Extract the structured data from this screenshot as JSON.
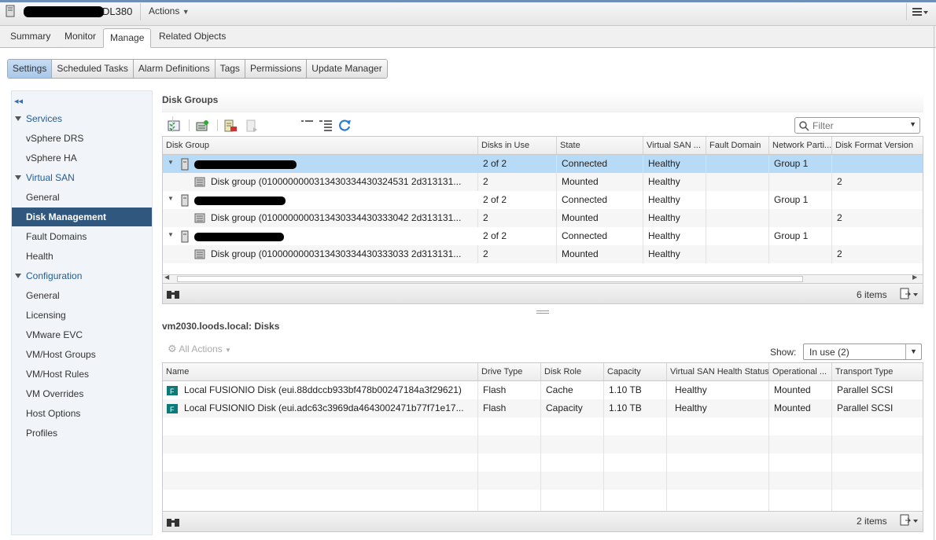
{
  "window": {
    "title": "DL380",
    "actions_label": "Actions"
  },
  "main_tabs": [
    "Summary",
    "Monitor",
    "Manage",
    "Related Objects"
  ],
  "sub_tabs": [
    "Settings",
    "Scheduled Tasks",
    "Alarm Definitions",
    "Tags",
    "Permissions",
    "Update Manager"
  ],
  "nav": {
    "services": "Services",
    "services_items": [
      "vSphere DRS",
      "vSphere HA"
    ],
    "vsan": "Virtual SAN",
    "vsan_items": [
      "General",
      "Disk Management",
      "Fault Domains",
      "Health"
    ],
    "configuration": "Configuration",
    "config_items": [
      "General",
      "Licensing",
      "VMware EVC",
      "VM/Host Groups",
      "VM/Host Rules",
      "VM Overrides",
      "Host Options",
      "Profiles"
    ]
  },
  "disk_groups": {
    "title": "Disk Groups",
    "filter_placeholder": "Filter",
    "columns": [
      "Disk Group",
      "Disks in Use",
      "State",
      "Virtual SAN ...",
      "Fault Domain",
      "Network Parti...",
      "Disk Format Version"
    ],
    "rows": [
      {
        "name": "",
        "disks": "2 of 2",
        "state": "Connected",
        "health": "Healthy",
        "fault": "",
        "net": "Group 1",
        "ver": ""
      },
      {
        "name": "Disk group (0100000000313430334430324531 2d313131...",
        "disks": "2",
        "state": "Mounted",
        "health": "Healthy",
        "fault": "",
        "net": "",
        "ver": "2"
      },
      {
        "name": "",
        "disks": "2 of 2",
        "state": "Connected",
        "health": "Healthy",
        "fault": "",
        "net": "Group 1",
        "ver": ""
      },
      {
        "name": "Disk group (0100000000313430334430333042 2d313131...",
        "disks": "2",
        "state": "Mounted",
        "health": "Healthy",
        "fault": "",
        "net": "",
        "ver": "2"
      },
      {
        "name": "",
        "disks": "2 of 2",
        "state": "Connected",
        "health": "Healthy",
        "fault": "",
        "net": "Group 1",
        "ver": ""
      },
      {
        "name": "Disk group (0100000000313430334430333033 2d313131...",
        "disks": "2",
        "state": "Mounted",
        "health": "Healthy",
        "fault": "",
        "net": "",
        "ver": "2"
      }
    ],
    "items_count": "6 items"
  },
  "disks": {
    "title": "vm2030.loods.local: Disks",
    "all_actions": "All Actions",
    "show_label": "Show:",
    "show_value": "In use (2)",
    "columns": [
      "Name",
      "Drive Type",
      "Disk Role",
      "Capacity",
      "Virtual SAN Health Status",
      "Operational ...",
      "Transport Type"
    ],
    "rows": [
      {
        "name": "Local FUSIONIO Disk (eui.88ddccb933bf478b00247184a3f29621)",
        "type": "Flash",
        "role": "Cache",
        "cap": "1.10 TB",
        "health": "Healthy",
        "op": "Mounted",
        "transport": "Parallel SCSI"
      },
      {
        "name": "Local FUSIONIO Disk (eui.adc63c3969da4643002471b77f71e17...",
        "type": "Flash",
        "role": "Capacity",
        "cap": "1.10 TB",
        "health": "Healthy",
        "op": "Mounted",
        "transport": "Parallel SCSI"
      }
    ],
    "items_count": "2 items"
  }
}
